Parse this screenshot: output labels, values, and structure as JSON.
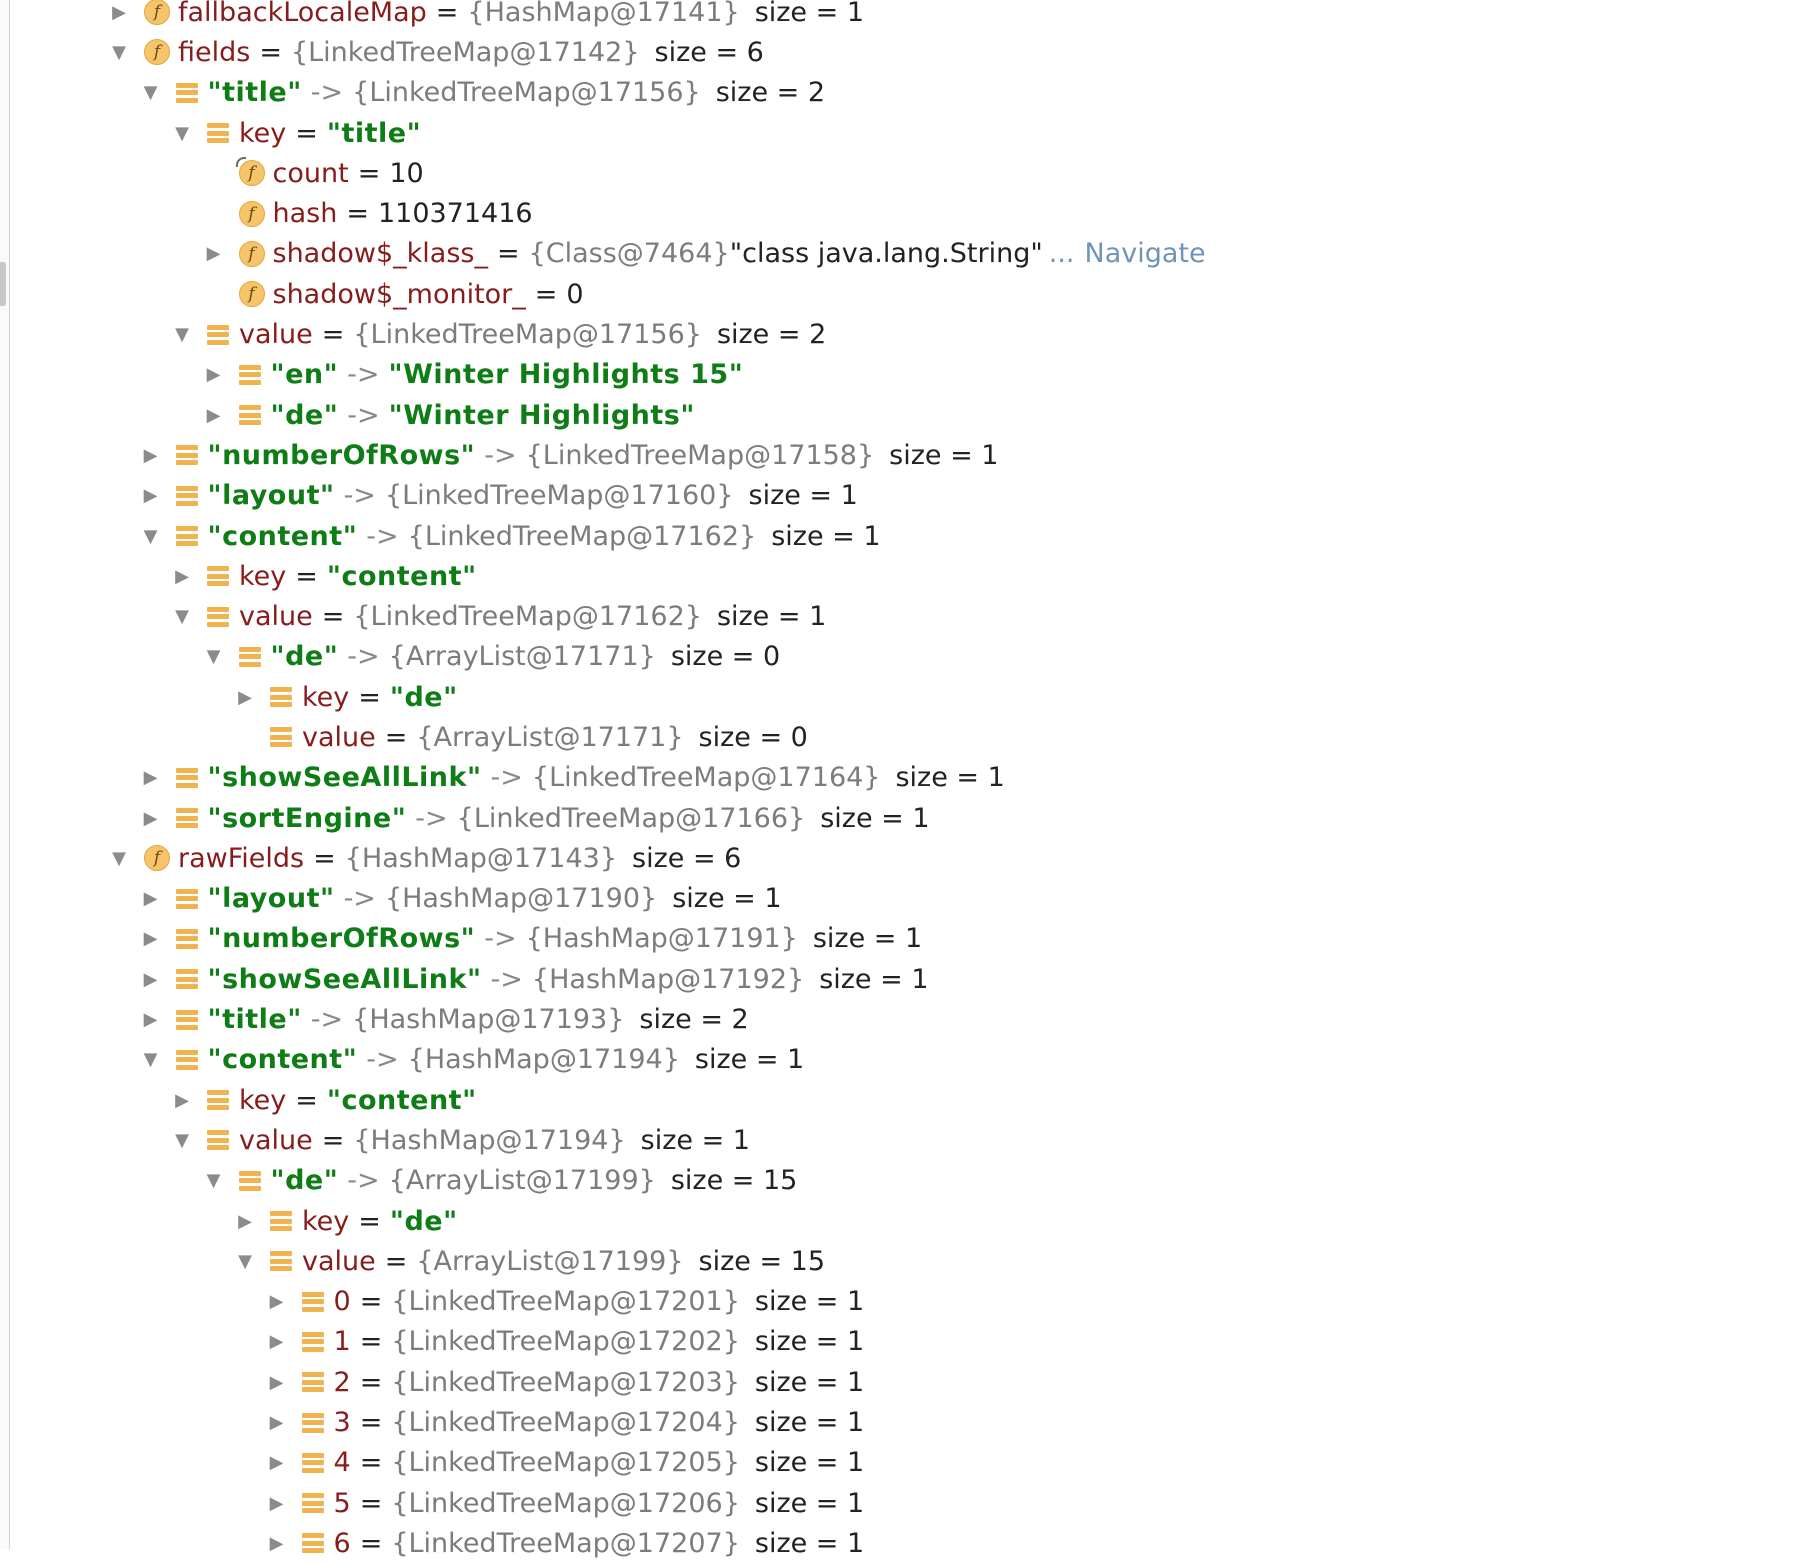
{
  "nodes": [
    {
      "level": 0,
      "arrow": "collapsed",
      "icon": "field",
      "name": "fallbackLocaleMap",
      "name_style": "name",
      "op": " = ",
      "ref": "{HashMap@17141}",
      "size": "size = 1"
    },
    {
      "level": 0,
      "arrow": "expanded",
      "icon": "field",
      "name": "fields",
      "name_style": "name",
      "op": " = ",
      "ref": "{LinkedTreeMap@17142}",
      "size": "size = 6"
    },
    {
      "level": 1,
      "arrow": "expanded",
      "icon": "entry",
      "name": "\"title\"",
      "name_style": "key",
      "op": " -> ",
      "ref": "{LinkedTreeMap@17156}",
      "size": "size = 2"
    },
    {
      "level": 2,
      "arrow": "expanded",
      "icon": "entry",
      "name": "key",
      "name_style": "name",
      "op": " = ",
      "value": "\"title\""
    },
    {
      "level": 3,
      "arrow": "none",
      "icon": "field-partial",
      "name": "count",
      "name_style": "name",
      "op": " = ",
      "plain": "10"
    },
    {
      "level": 3,
      "arrow": "none",
      "icon": "field",
      "name": "hash",
      "name_style": "name",
      "op": " = ",
      "plain": "110371416"
    },
    {
      "level": 3,
      "arrow": "collapsed",
      "icon": "field",
      "name": "shadow$_klass_",
      "name_style": "name",
      "op": " = ",
      "ref": "{Class@7464}",
      "plain": " \"class java.lang.String\"",
      "nav_dots": "...",
      "nav": "Navigate"
    },
    {
      "level": 3,
      "arrow": "none",
      "icon": "field",
      "name": "shadow$_monitor_",
      "name_style": "name",
      "op": " = ",
      "plain": "0"
    },
    {
      "level": 2,
      "arrow": "expanded",
      "icon": "entry",
      "name": "value",
      "name_style": "name",
      "op": " = ",
      "ref": "{LinkedTreeMap@17156}",
      "size": "size = 2"
    },
    {
      "level": 3,
      "arrow": "collapsed",
      "icon": "entry",
      "name": "\"en\"",
      "name_style": "key",
      "op": " -> ",
      "value": "\"Winter Highlights 15\""
    },
    {
      "level": 3,
      "arrow": "collapsed",
      "icon": "entry",
      "name": "\"de\"",
      "name_style": "key",
      "op": " -> ",
      "value": "\"Winter Highlights\""
    },
    {
      "level": 1,
      "arrow": "collapsed",
      "icon": "entry",
      "name": "\"numberOfRows\"",
      "name_style": "key",
      "op": " -> ",
      "ref": "{LinkedTreeMap@17158}",
      "size": "size = 1"
    },
    {
      "level": 1,
      "arrow": "collapsed",
      "icon": "entry",
      "name": "\"layout\"",
      "name_style": "key",
      "op": " -> ",
      "ref": "{LinkedTreeMap@17160}",
      "size": "size = 1"
    },
    {
      "level": 1,
      "arrow": "expanded",
      "icon": "entry",
      "name": "\"content\"",
      "name_style": "key",
      "op": " -> ",
      "ref": "{LinkedTreeMap@17162}",
      "size": "size = 1"
    },
    {
      "level": 2,
      "arrow": "collapsed",
      "icon": "entry",
      "name": "key",
      "name_style": "name",
      "op": " = ",
      "value": "\"content\""
    },
    {
      "level": 2,
      "arrow": "expanded",
      "icon": "entry",
      "name": "value",
      "name_style": "name",
      "op": " = ",
      "ref": "{LinkedTreeMap@17162}",
      "size": "size = 1"
    },
    {
      "level": 3,
      "arrow": "expanded",
      "icon": "entry",
      "name": "\"de\"",
      "name_style": "key",
      "op": " -> ",
      "ref": "{ArrayList@17171}",
      "size": "size = 0"
    },
    {
      "level": 4,
      "arrow": "collapsed",
      "icon": "entry",
      "name": "key",
      "name_style": "name",
      "op": " = ",
      "value": "\"de\""
    },
    {
      "level": 4,
      "arrow": "none",
      "icon": "entry",
      "name": "value",
      "name_style": "name",
      "op": " = ",
      "ref": "{ArrayList@17171}",
      "size": "size = 0"
    },
    {
      "level": 1,
      "arrow": "collapsed",
      "icon": "entry",
      "name": "\"showSeeAllLink\"",
      "name_style": "key",
      "op": " -> ",
      "ref": "{LinkedTreeMap@17164}",
      "size": "size = 1"
    },
    {
      "level": 1,
      "arrow": "collapsed",
      "icon": "entry",
      "name": "\"sortEngine\"",
      "name_style": "key",
      "op": " -> ",
      "ref": "{LinkedTreeMap@17166}",
      "size": "size = 1"
    },
    {
      "level": 0,
      "arrow": "expanded",
      "icon": "field",
      "name": "rawFields",
      "name_style": "name",
      "op": " = ",
      "ref": "{HashMap@17143}",
      "size": "size = 6"
    },
    {
      "level": 1,
      "arrow": "collapsed",
      "icon": "entry",
      "name": "\"layout\"",
      "name_style": "key",
      "op": " -> ",
      "ref": "{HashMap@17190}",
      "size": "size = 1"
    },
    {
      "level": 1,
      "arrow": "collapsed",
      "icon": "entry",
      "name": "\"numberOfRows\"",
      "name_style": "key",
      "op": " -> ",
      "ref": "{HashMap@17191}",
      "size": "size = 1"
    },
    {
      "level": 1,
      "arrow": "collapsed",
      "icon": "entry",
      "name": "\"showSeeAllLink\"",
      "name_style": "key",
      "op": " -> ",
      "ref": "{HashMap@17192}",
      "size": "size = 1"
    },
    {
      "level": 1,
      "arrow": "collapsed",
      "icon": "entry",
      "name": "\"title\"",
      "name_style": "key",
      "op": " -> ",
      "ref": "{HashMap@17193}",
      "size": "size = 2"
    },
    {
      "level": 1,
      "arrow": "expanded",
      "icon": "entry",
      "name": "\"content\"",
      "name_style": "key",
      "op": " -> ",
      "ref": "{HashMap@17194}",
      "size": "size = 1"
    },
    {
      "level": 2,
      "arrow": "collapsed",
      "icon": "entry",
      "name": "key",
      "name_style": "name",
      "op": " = ",
      "value": "\"content\""
    },
    {
      "level": 2,
      "arrow": "expanded",
      "icon": "entry",
      "name": "value",
      "name_style": "name",
      "op": " = ",
      "ref": "{HashMap@17194}",
      "size": "size = 1"
    },
    {
      "level": 3,
      "arrow": "expanded",
      "icon": "entry",
      "name": "\"de\"",
      "name_style": "key",
      "op": " -> ",
      "ref": "{ArrayList@17199}",
      "size": "size = 15"
    },
    {
      "level": 4,
      "arrow": "collapsed",
      "icon": "entry",
      "name": "key",
      "name_style": "name",
      "op": " = ",
      "value": "\"de\""
    },
    {
      "level": 4,
      "arrow": "expanded",
      "icon": "entry",
      "name": "value",
      "name_style": "name",
      "op": " = ",
      "ref": "{ArrayList@17199}",
      "size": "size = 15"
    },
    {
      "level": 5,
      "arrow": "collapsed",
      "icon": "entry",
      "name": "0",
      "name_style": "name",
      "op": " = ",
      "ref": "{LinkedTreeMap@17201}",
      "size": "size = 1"
    },
    {
      "level": 5,
      "arrow": "collapsed",
      "icon": "entry",
      "name": "1",
      "name_style": "name",
      "op": " = ",
      "ref": "{LinkedTreeMap@17202}",
      "size": "size = 1"
    },
    {
      "level": 5,
      "arrow": "collapsed",
      "icon": "entry",
      "name": "2",
      "name_style": "name",
      "op": " = ",
      "ref": "{LinkedTreeMap@17203}",
      "size": "size = 1"
    },
    {
      "level": 5,
      "arrow": "collapsed",
      "icon": "entry",
      "name": "3",
      "name_style": "name",
      "op": " = ",
      "ref": "{LinkedTreeMap@17204}",
      "size": "size = 1"
    },
    {
      "level": 5,
      "arrow": "collapsed",
      "icon": "entry",
      "name": "4",
      "name_style": "name",
      "op": " = ",
      "ref": "{LinkedTreeMap@17205}",
      "size": "size = 1"
    },
    {
      "level": 5,
      "arrow": "collapsed",
      "icon": "entry",
      "name": "5",
      "name_style": "name",
      "op": " = ",
      "ref": "{LinkedTreeMap@17206}",
      "size": "size = 1"
    },
    {
      "level": 5,
      "arrow": "collapsed",
      "icon": "entry",
      "name": "6",
      "name_style": "name",
      "op": " = ",
      "ref": "{LinkedTreeMap@17207}",
      "size": "size = 1"
    }
  ],
  "icons": {
    "expanded": "▼",
    "collapsed": "▶",
    "field_letter": "f"
  },
  "colors": {
    "field_name": "#871c1c",
    "string_key": "#0f7d16",
    "reference": "#7c7c7c",
    "navigate_link": "#6f94b8",
    "icon_orange": "#f5c46b"
  }
}
